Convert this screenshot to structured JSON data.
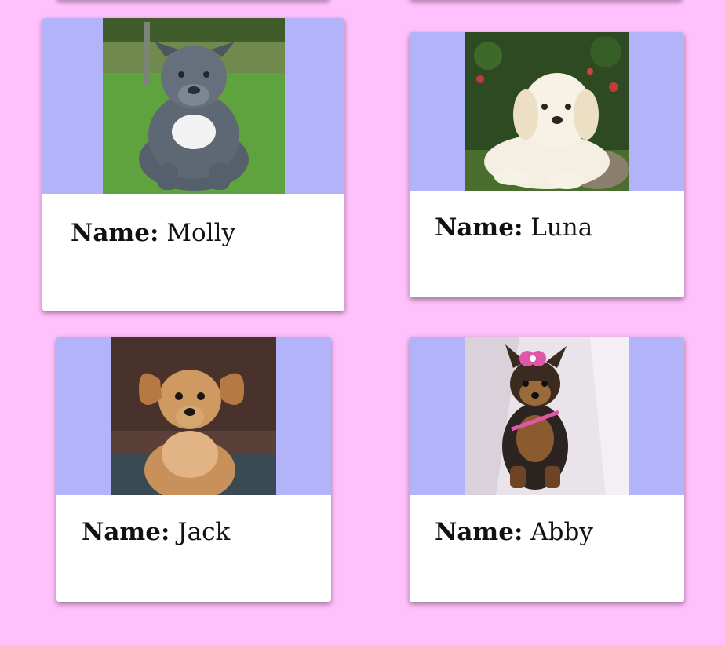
{
  "name_prefix": "Name:",
  "cards": [
    {
      "name": "Molly",
      "breed_hint": "pitbull-puppy"
    },
    {
      "name": "Luna",
      "breed_hint": "golden-retriever-puppy"
    },
    {
      "name": "Jack",
      "breed_hint": "dachshund-puppy"
    },
    {
      "name": "Abby",
      "breed_hint": "yorkshire-terrier-puppy"
    }
  ],
  "colors": {
    "page_background": "#FFC0FB",
    "card_background": "#FFFFFF",
    "media_background": "#B3B3F9",
    "text": "#111111"
  }
}
